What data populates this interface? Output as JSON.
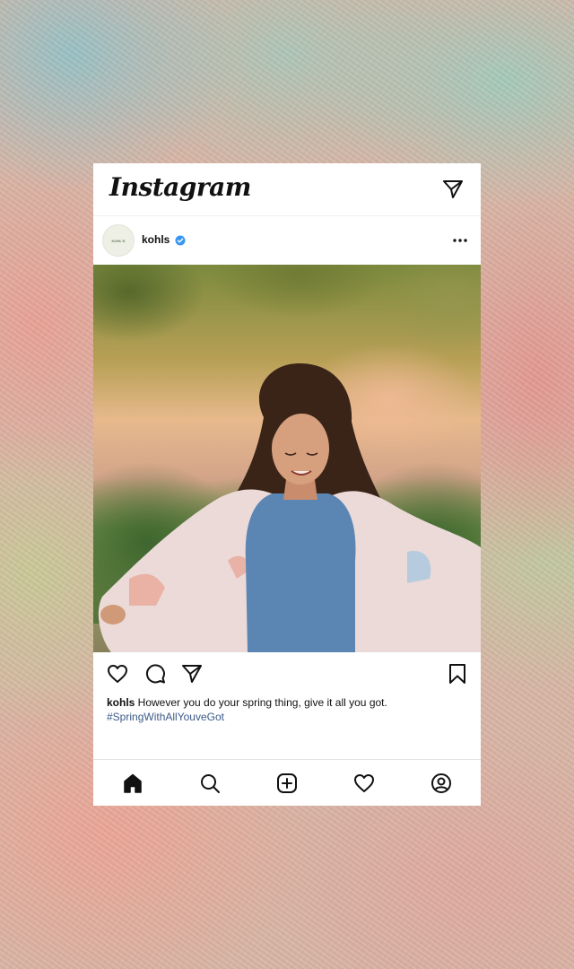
{
  "app": {
    "title": "Instagram"
  },
  "post": {
    "username": "kohls",
    "avatar_label": "KOHL'S",
    "verified_icon": "verified-badge-icon",
    "caption_user": "kohls",
    "caption_text": " However you do your spring thing, give it all you got.",
    "hashtag": "#SpringWithAllYouveGot"
  },
  "icons": {
    "header": [
      "direct-message-icon"
    ],
    "post_header": [
      "more-options-icon"
    ],
    "actions": [
      "heart-icon",
      "comment-icon",
      "share-icon",
      "bookmark-icon"
    ],
    "bottom_nav": [
      "home-icon",
      "search-icon",
      "create-icon",
      "activity-icon",
      "profile-icon"
    ]
  },
  "colors": {
    "verified": "#3897f0",
    "hashtag": "#3b5a86",
    "text": "#111111"
  }
}
